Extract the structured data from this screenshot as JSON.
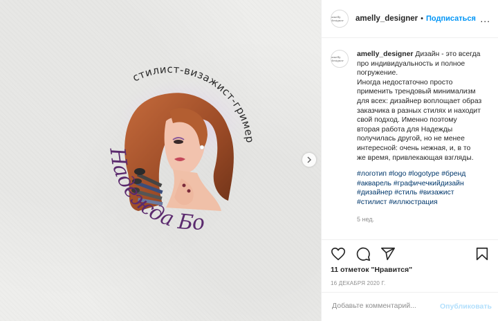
{
  "post": {
    "username": "amelly_designer",
    "follow_label": "Подписаться",
    "more_label": "...",
    "avatar_text": "amelly designer",
    "caption_lines": [
      "Дизайн - это всегда",
      "про индивидуальность и полное",
      "погружение.",
      "Иногда недостаточно просто",
      "применить трендовый минимализм",
      "для всех: дизайнер воплощает образ",
      "заказчика в разных стилях и находит",
      "свой подход. Именно поэтому",
      "вторая работа для Надежды",
      "получилась другой, но не менее",
      "интересной: очень нежная, и, в то",
      "же время, привлекающая взгляды."
    ],
    "hashtag_lines": [
      [
        "#логотип",
        "#logo",
        "#logotype",
        "#бренд"
      ],
      [
        "#акварель",
        "#графичечкийдизайн"
      ],
      [
        "#дизайнер",
        "#стиль",
        "#визажист"
      ],
      [
        "#стилист",
        "#иллюстрация"
      ]
    ],
    "time_ago": "5 нед.",
    "likes": "11 отметок \"Нравится\"",
    "date": "16 ДЕКАБРЯ 2020 Г.",
    "comment_placeholder": "Добавьте комментарий...",
    "publish_label": "Опубликовать"
  },
  "image": {
    "arc_text": "стилист-визажист-гример",
    "name_text": "Надежда Бойко"
  },
  "colors": {
    "link": "#0095f6",
    "hashtag": "#00376b",
    "muted": "#8e8e8e",
    "publish_disabled": "#b2dffc",
    "logo_purple": "#5b2a6e",
    "hair": "#a8552e"
  },
  "icons": [
    "heart-icon",
    "comment-icon",
    "share-icon",
    "bookmark-icon",
    "chevron-right-icon",
    "more-icon"
  ]
}
